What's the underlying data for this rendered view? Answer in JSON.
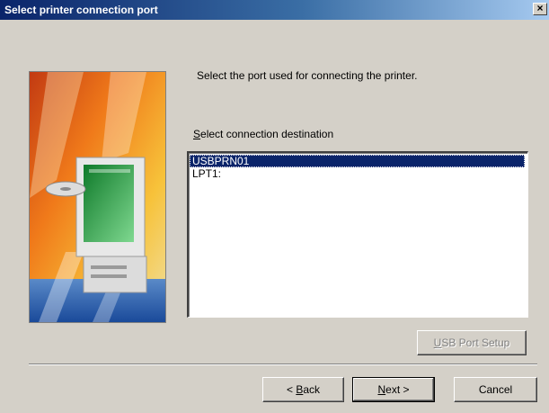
{
  "window": {
    "title": "Select printer connection port",
    "close_glyph": "×"
  },
  "prompt": "Select the port used for connecting the printer.",
  "list": {
    "label_mnemonic": "S",
    "label_rest": "elect connection destination",
    "items": [
      "USBPRN01",
      "LPT1:"
    ],
    "selected": "USBPRN01"
  },
  "buttons": {
    "usb_port_setup": {
      "mnemonic": "U",
      "rest": "SB Port Setup",
      "enabled": false
    },
    "back": {
      "prefix": "< ",
      "mnemonic": "B",
      "rest": "ack"
    },
    "next": {
      "mnemonic": "N",
      "rest": "ext >"
    },
    "cancel": {
      "label": "Cancel"
    }
  },
  "colors": {
    "title_bar": "#0a246a",
    "dialog_face": "#d4d0c8",
    "selection": "#0a246a"
  },
  "icons": {
    "banner": "computer-illustration"
  }
}
